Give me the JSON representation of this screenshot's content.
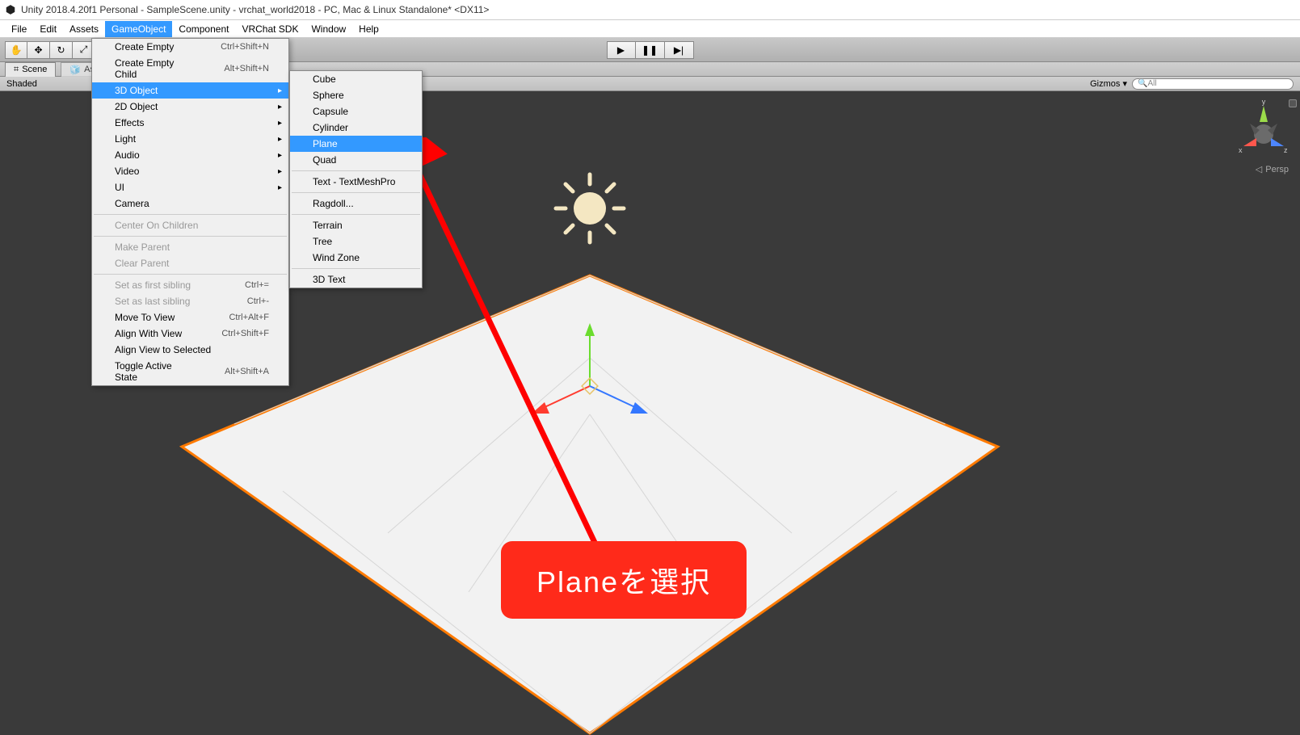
{
  "window": {
    "title": "Unity 2018.4.20f1 Personal - SampleScene.unity - vrchat_world2018 - PC, Mac & Linux Standalone* <DX11>"
  },
  "menubar": {
    "items": [
      "File",
      "Edit",
      "Assets",
      "GameObject",
      "Component",
      "VRChat SDK",
      "Window",
      "Help"
    ],
    "active_index": 3
  },
  "toolbar": {
    "hand": "✋",
    "move": "✥",
    "rotate": "↻",
    "scale": "⤢",
    "rect": "▭",
    "play": "▶",
    "pause": "❚❚",
    "step": "▶|"
  },
  "tabs": {
    "scene": "Scene",
    "asset": "Ass"
  },
  "subbar": {
    "shaded": "Shaded",
    "gizmos": "Gizmos",
    "search_placeholder": "All"
  },
  "scene_overlay": {
    "persp": "Persp",
    "axis_x": "x",
    "axis_y": "y",
    "axis_z": "z"
  },
  "menu_gameobject": {
    "items": [
      {
        "label": "Create Empty",
        "shortcut": "Ctrl+Shift+N"
      },
      {
        "label": "Create Empty Child",
        "shortcut": "Alt+Shift+N"
      },
      {
        "label": "3D Object",
        "sub": true,
        "highlight": true
      },
      {
        "label": "2D Object",
        "sub": true
      },
      {
        "label": "Effects",
        "sub": true
      },
      {
        "label": "Light",
        "sub": true
      },
      {
        "label": "Audio",
        "sub": true
      },
      {
        "label": "Video",
        "sub": true
      },
      {
        "label": "UI",
        "sub": true
      },
      {
        "label": "Camera"
      },
      {
        "sep": true
      },
      {
        "label": "Center On Children",
        "disabled": true
      },
      {
        "sep": true
      },
      {
        "label": "Make Parent",
        "disabled": true
      },
      {
        "label": "Clear Parent",
        "disabled": true
      },
      {
        "sep": true
      },
      {
        "label": "Set as first sibling",
        "shortcut": "Ctrl+=",
        "disabled": true
      },
      {
        "label": "Set as last sibling",
        "shortcut": "Ctrl+-",
        "disabled": true
      },
      {
        "label": "Move To View",
        "shortcut": "Ctrl+Alt+F"
      },
      {
        "label": "Align With View",
        "shortcut": "Ctrl+Shift+F"
      },
      {
        "label": "Align View to Selected"
      },
      {
        "label": "Toggle Active State",
        "shortcut": "Alt+Shift+A"
      }
    ]
  },
  "menu_3dobject": {
    "items": [
      {
        "label": "Cube"
      },
      {
        "label": "Sphere"
      },
      {
        "label": "Capsule"
      },
      {
        "label": "Cylinder"
      },
      {
        "label": "Plane",
        "highlight": true
      },
      {
        "label": "Quad"
      },
      {
        "sep": true
      },
      {
        "label": "Text - TextMeshPro"
      },
      {
        "sep": true
      },
      {
        "label": "Ragdoll..."
      },
      {
        "sep": true
      },
      {
        "label": "Terrain"
      },
      {
        "label": "Tree"
      },
      {
        "label": "Wind Zone"
      },
      {
        "sep": true
      },
      {
        "label": "3D Text"
      }
    ]
  },
  "annotation": {
    "text": "Planeを選択"
  }
}
